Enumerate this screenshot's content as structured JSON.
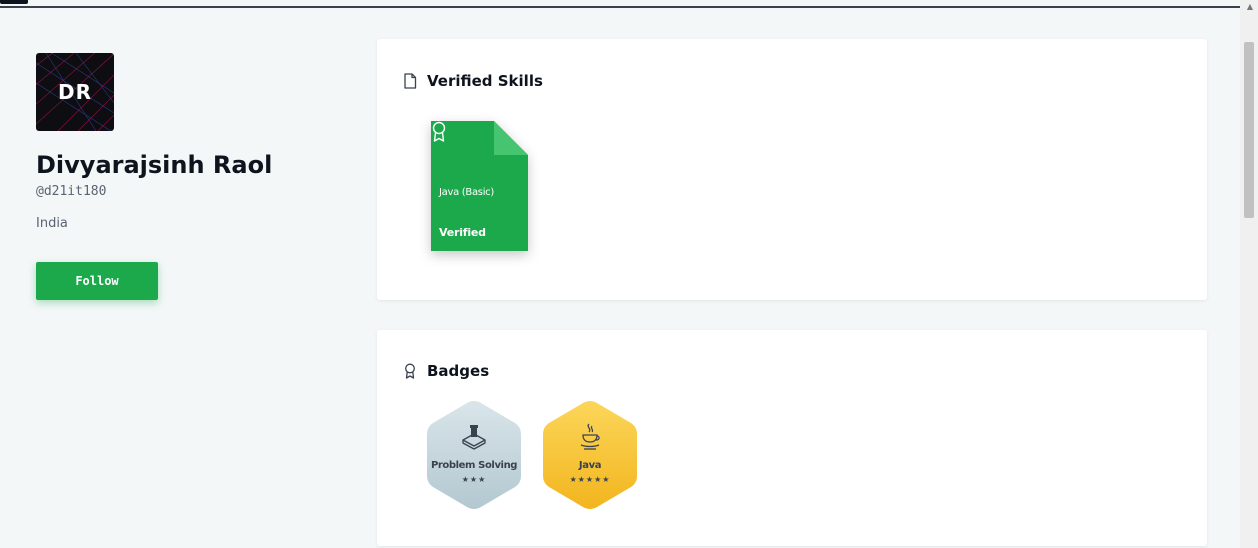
{
  "profile": {
    "avatar_initials": "DR",
    "name": "Divyarajsinh Raol",
    "handle": "@d21it180",
    "country": "India",
    "follow_label": "Follow"
  },
  "verified_skills": {
    "title": "Verified Skills",
    "items": [
      {
        "name": "Java (Basic)",
        "status": "Verified",
        "color": "#1ba94c"
      }
    ]
  },
  "badges": {
    "title": "Badges",
    "items": [
      {
        "name": "Problem Solving",
        "stars": "★★★",
        "star_count": 3,
        "icon": "chess-rook-icon",
        "color": "#c6d6dc"
      },
      {
        "name": "Java",
        "stars": "★★★★★",
        "star_count": 5,
        "icon": "java-cup-icon",
        "color": "#f5c842"
      }
    ]
  },
  "colors": {
    "accent": "#1ba94c",
    "background": "#f3f7f7",
    "card": "#ffffff",
    "text": "#0e141e"
  }
}
